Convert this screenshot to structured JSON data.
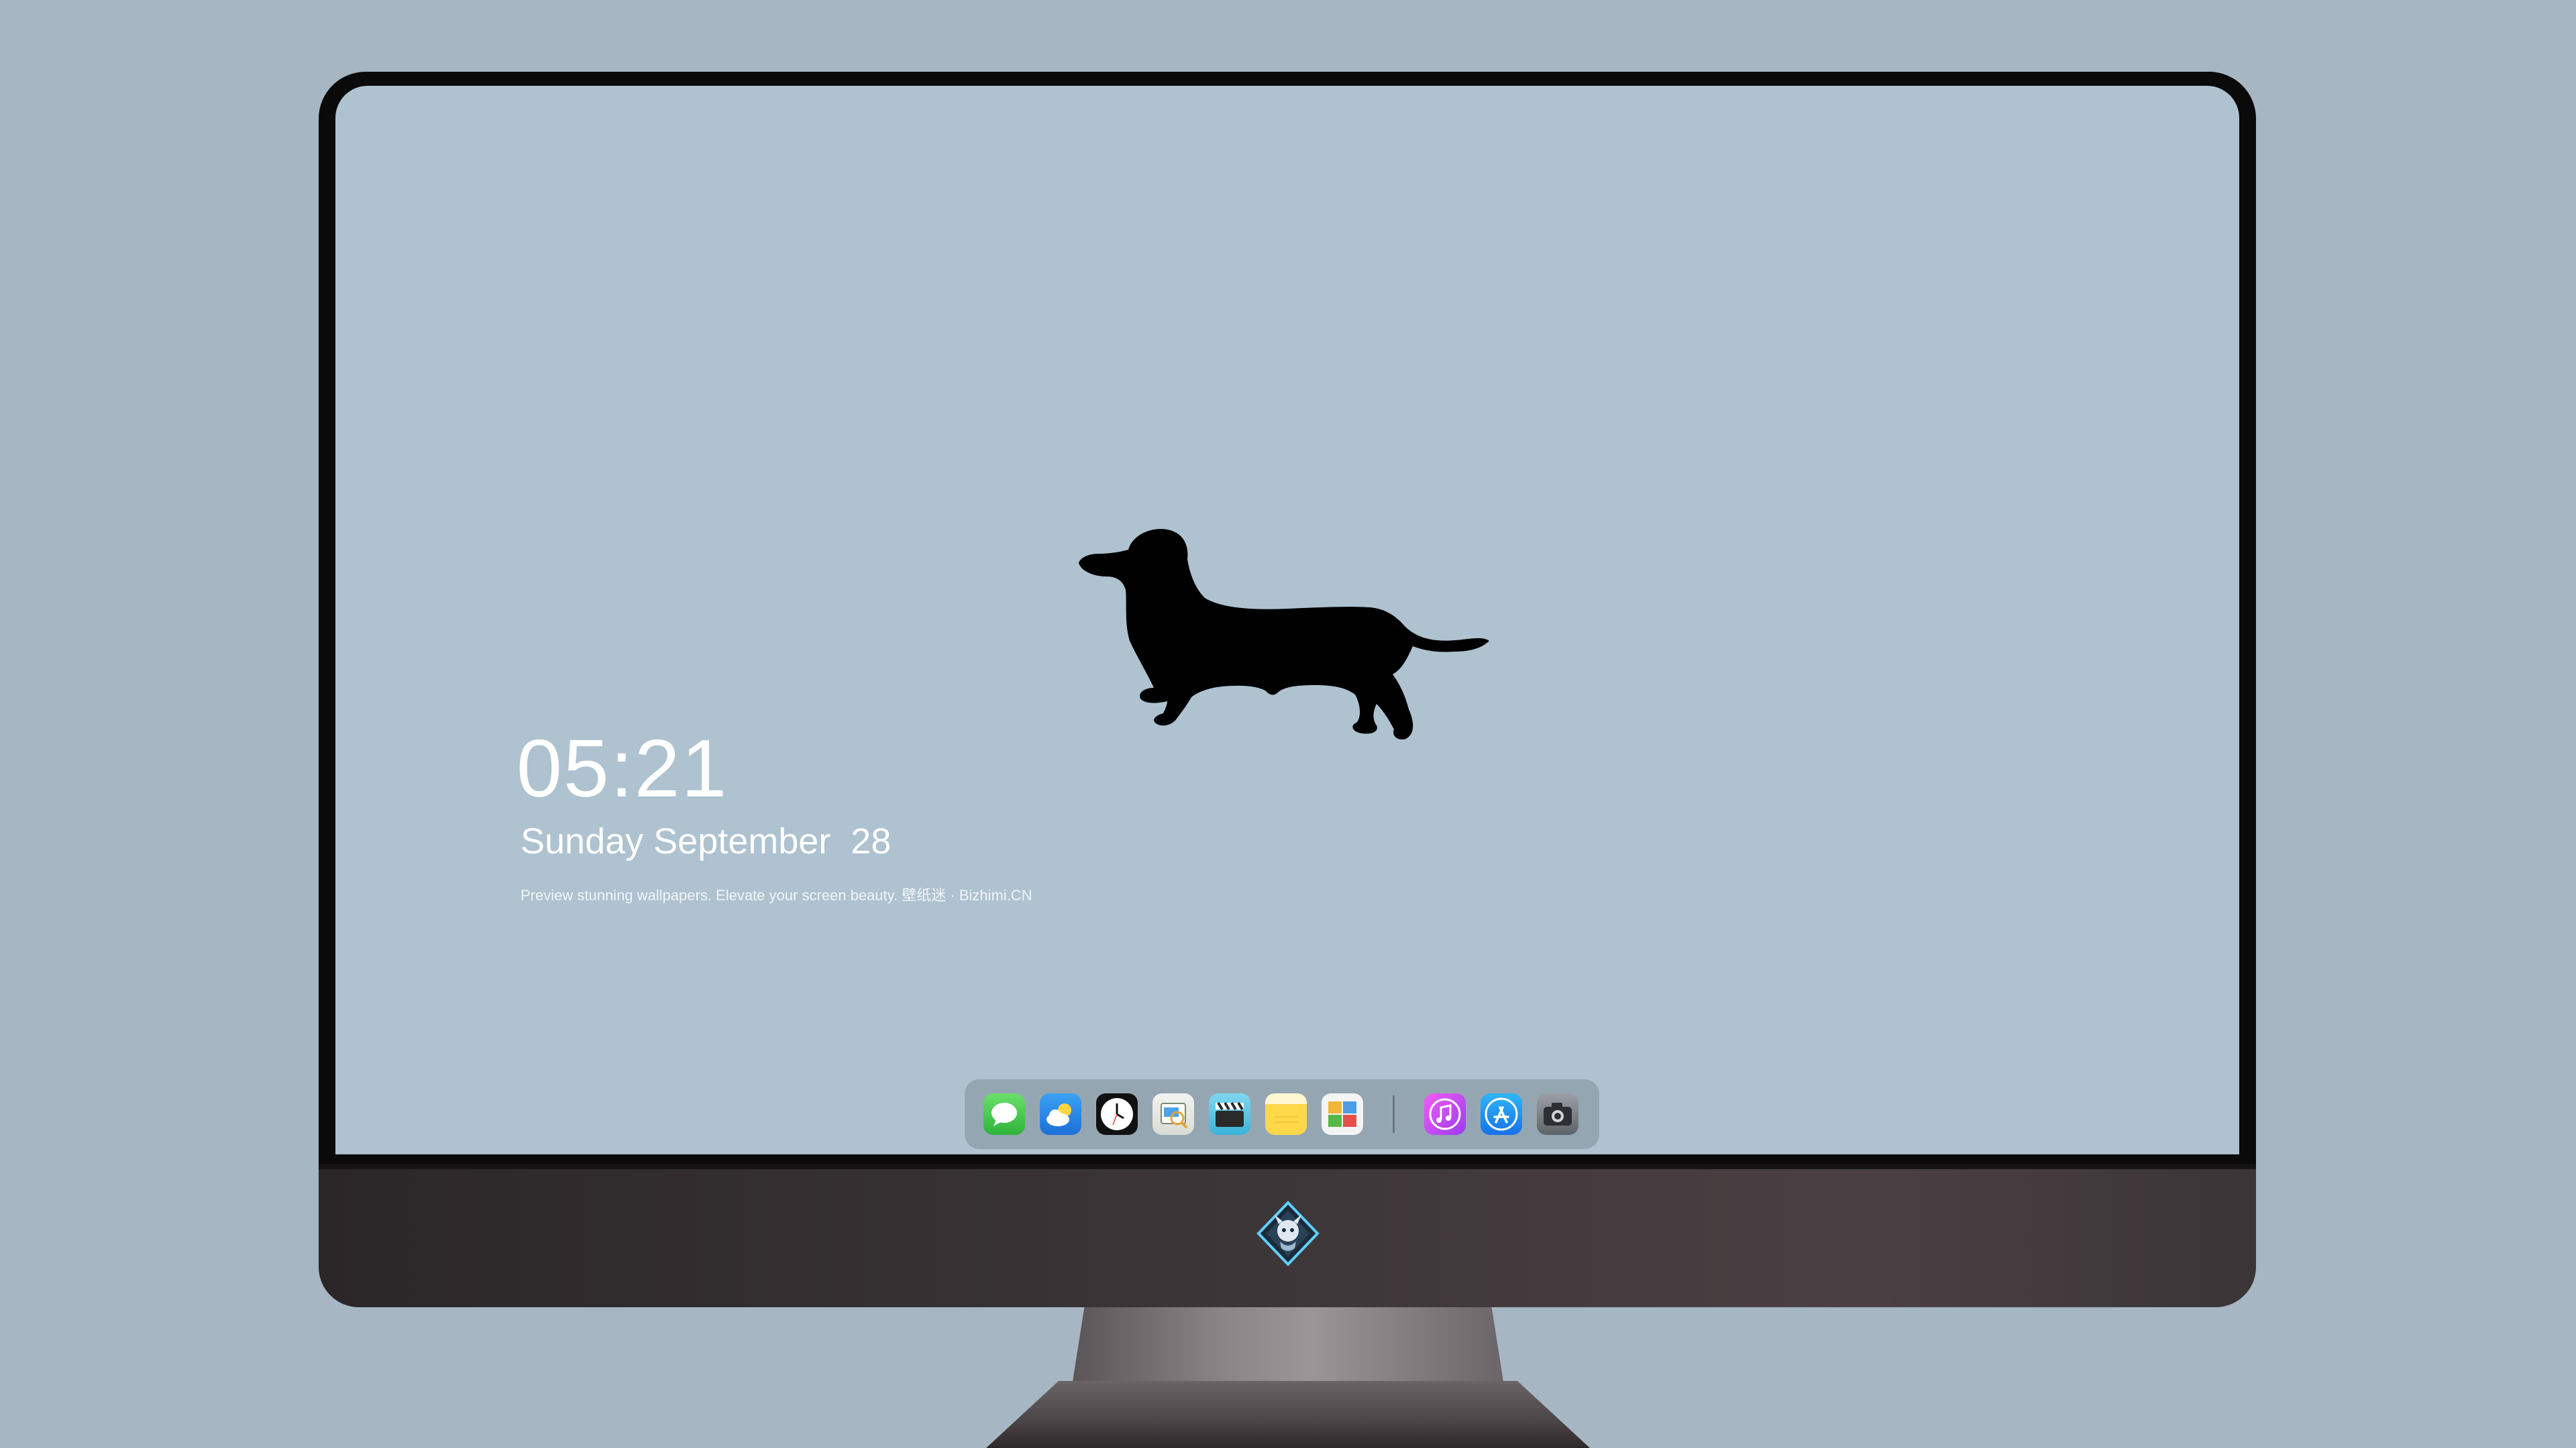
{
  "lockscreen": {
    "time": "05:21",
    "date": "Sunday September  28",
    "tagline": "Preview stunning wallpapers. Elevate your screen beauty. 壁纸迷 · Bizhimi.CN"
  },
  "wallpaper": {
    "subject": "dachshund-silhouette",
    "background_color": "#aec2d0",
    "subject_color": "#000000"
  },
  "dock": {
    "items": [
      {
        "name": "messages",
        "icon": "speech-bubble-icon",
        "color": "#3cc44a"
      },
      {
        "name": "weather",
        "icon": "cloud-sun-icon",
        "color": "#2a8ef0"
      },
      {
        "name": "clock",
        "icon": "clock-icon",
        "color": "#111111"
      },
      {
        "name": "preview",
        "icon": "preview-icon",
        "color": "#e6e8e0"
      },
      {
        "name": "clips",
        "icon": "clapperboard-icon",
        "color": "#4cc4e4"
      },
      {
        "name": "notes",
        "icon": "notepad-icon",
        "color": "#ffd84a"
      },
      {
        "name": "photos",
        "icon": "photos-icon",
        "color": "#f4f4f4"
      },
      {
        "name": "music",
        "icon": "music-note-icon",
        "color": "#d04cf2"
      },
      {
        "name": "app-store",
        "icon": "app-store-icon",
        "color": "#1e8ef0"
      },
      {
        "name": "camera",
        "icon": "camera-icon",
        "color": "#7a7f84"
      }
    ]
  },
  "monitor": {
    "bezel_color": "#0a0a0b",
    "chin_color": "#3b3537",
    "backdrop_color": "#a6b6c2"
  }
}
